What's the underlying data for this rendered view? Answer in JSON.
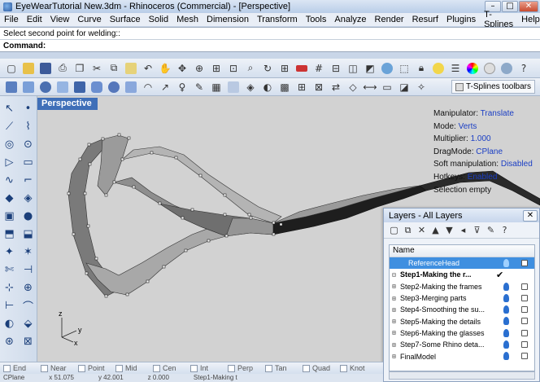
{
  "window": {
    "title": "EyeWearTutorial New.3dm - Rhinoceros (Commercial) - [Perspective]"
  },
  "menu": [
    "File",
    "Edit",
    "View",
    "Curve",
    "Surface",
    "Solid",
    "Mesh",
    "Dimension",
    "Transform",
    "Tools",
    "Analyze",
    "Render",
    "Resurf",
    "Plugins",
    "T-Splines",
    "Help"
  ],
  "command": {
    "history": "Select second point for welding::",
    "prompt": "Command:"
  },
  "toolbar": {
    "tsplines_label": "T-Splines toolbars"
  },
  "viewport": {
    "label": "Perspective",
    "axis_x": "x",
    "axis_y": "y",
    "axis_z": "z"
  },
  "tsplines_info": [
    {
      "label": "Manipulator:",
      "value": "Translate"
    },
    {
      "label": "Mode:",
      "value": "Verts"
    },
    {
      "label": "Multiplier:",
      "value": "1.000"
    },
    {
      "label": "DragMode:",
      "value": "CPlane"
    },
    {
      "label": "Soft manipulation:",
      "value": "Disabled"
    },
    {
      "label": "Hotkeys:",
      "value": "Enabled"
    },
    {
      "label": "Selection empty",
      "value": ""
    }
  ],
  "layers": {
    "title": "Layers - All Layers",
    "column_name": "Name",
    "rows": [
      {
        "name": "ReferenceHead",
        "selected": true,
        "current": false,
        "child": true
      },
      {
        "name": "Step1-Making the r...",
        "selected": false,
        "current": true,
        "child": false
      },
      {
        "name": "Step2-Making the frames",
        "selected": false,
        "current": false,
        "child": false
      },
      {
        "name": "Step3-Merging parts",
        "selected": false,
        "current": false,
        "child": false
      },
      {
        "name": "Step4-Smoothing the su...",
        "selected": false,
        "current": false,
        "child": false
      },
      {
        "name": "Step5-Making the details",
        "selected": false,
        "current": false,
        "child": false
      },
      {
        "name": "Step6-Making the glasses",
        "selected": false,
        "current": false,
        "child": false
      },
      {
        "name": "Step7-Some Rhino deta...",
        "selected": false,
        "current": false,
        "child": false
      },
      {
        "name": "FinalModel",
        "selected": false,
        "current": false,
        "child": false
      }
    ],
    "current_mark": "✔"
  },
  "osnap": [
    "End",
    "Near",
    "Point",
    "Mid",
    "Cen",
    "Int",
    "Perp",
    "Tan",
    "Quad",
    "Knot"
  ],
  "status": {
    "cplane": "CPlane",
    "x": "x 51.075",
    "y": "y 42.001",
    "z": "z 0.000",
    "layer": "Step1-Making t"
  }
}
